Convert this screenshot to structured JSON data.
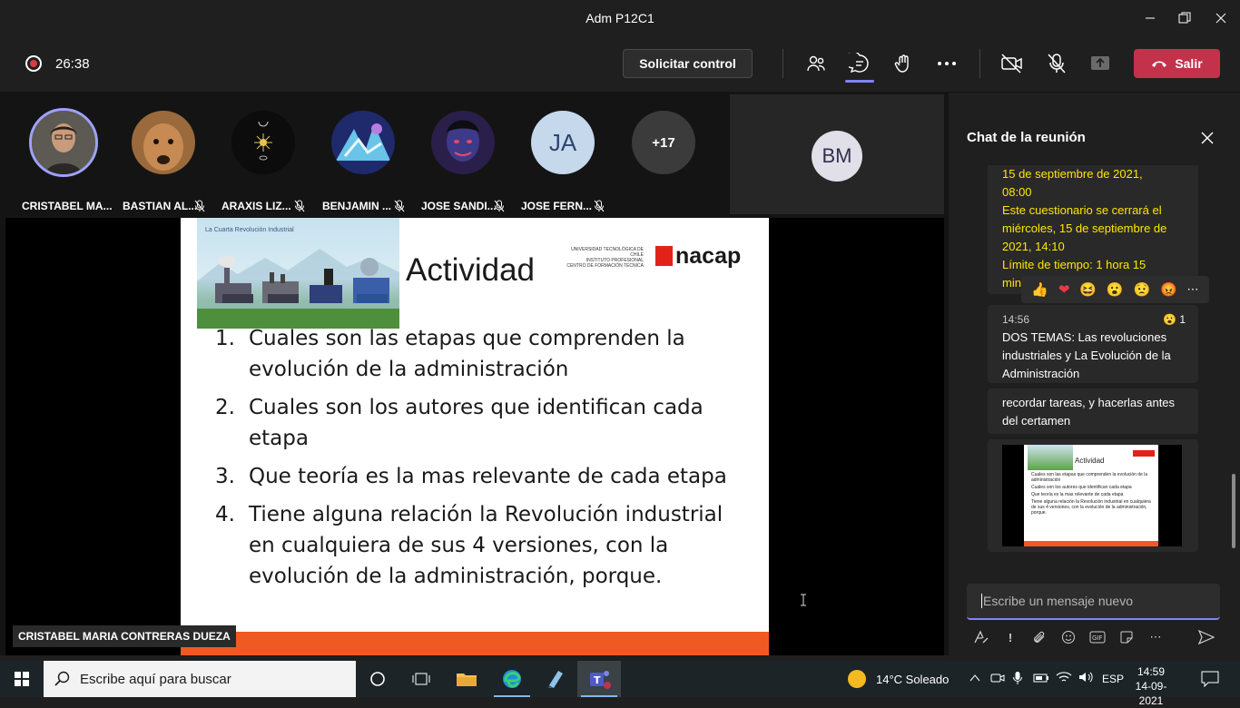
{
  "window": {
    "title": "Adm P12C1"
  },
  "meeting": {
    "timer": "26:38",
    "request_control_label": "Solicitar control",
    "leave_label": "Salir"
  },
  "participants": [
    {
      "name": "CRISTABEL MA...",
      "initials": ""
    },
    {
      "name": "BASTIAN AL...",
      "initials": ""
    },
    {
      "name": "ARAXIS LIZ...",
      "initials": ""
    },
    {
      "name": "BENJAMIN ...",
      "initials": ""
    },
    {
      "name": "JOSE SANDI...",
      "initials": ""
    },
    {
      "name": "JOSE FERN...",
      "initials": "JA"
    }
  ],
  "overflow_count": "+17",
  "bm_tile": {
    "initials": "BM"
  },
  "slide": {
    "image_caption": "La Cuarta Revolución Industrial",
    "title": "Actividad",
    "logo_text_lines": [
      "UNIVERSIDAD TECNOLÓGICA DE CHILE",
      "INSTITUTO PROFESIONAL",
      "CENTRO DE FORMACIÓN TÉCNICA"
    ],
    "logo_word": "nacap",
    "items": [
      {
        "num": "1.",
        "text": "Cuales son las etapas que comprenden la evolución de la administración"
      },
      {
        "num": "2.",
        "text": "Cuales son los autores que identifican cada etapa"
      },
      {
        "num": "3.",
        "text": "Que teoría es la mas relevante de cada etapa"
      },
      {
        "num": "4.",
        "text": "Tiene alguna relación la Revolución industrial en cualquiera de sus 4 versiones, con la evolución de la administración, porque."
      }
    ]
  },
  "presenter_name": "CRISTABEL MARIA CONTRERAS DUEZA",
  "chat": {
    "title": "Chat de la reunión",
    "yellow_message": "15 de septiembre de 2021, 08:00 Este cuestionario se cerrará el miércoles, 15 de septiembre de 2021, 14:10 Límite de tiempo: 1 hora 15 min",
    "yellow_lines": [
      "15 de septiembre de 2021,",
      "08:00",
      "Este cuestionario se cerrará el",
      "miércoles, 15 de septiembre de",
      "2021, 14:10",
      "Límite de tiempo: 1 hora 15",
      "min"
    ],
    "message2": {
      "time": "14:56",
      "reaction_count": "1",
      "text": "DOS TEMAS: Las revoluciones industriales y La Evolución de la Administración"
    },
    "message3": {
      "text": "recordar tareas, y hacerlas antes del certamen"
    },
    "thumbnail": {
      "title": "Actividad",
      "items": [
        "Cuales son las etapas que comprenden la evolución de la administración",
        "Cuales son los autores que identifican cada etapa",
        "Que teoría es la mas relevante de cada etapa",
        "Tiene alguna relación la Revolución industrial en cualquiera de sus 4 versiones, con la evolución de la administración, porque."
      ]
    },
    "compose_placeholder": "Escribe un mensaje nuevo"
  },
  "taskbar": {
    "search_placeholder": "Escribe aquí para buscar",
    "weather": "14°C  Soleado",
    "language": "ESP",
    "time": "14:59",
    "date": "14-09-2021"
  },
  "colors": {
    "accent": "#7f85f5",
    "leave": "#c4314b",
    "inacap_red": "#e2231a",
    "slide_bar": "#f05a22",
    "chat_highlight": "#ffe600"
  }
}
